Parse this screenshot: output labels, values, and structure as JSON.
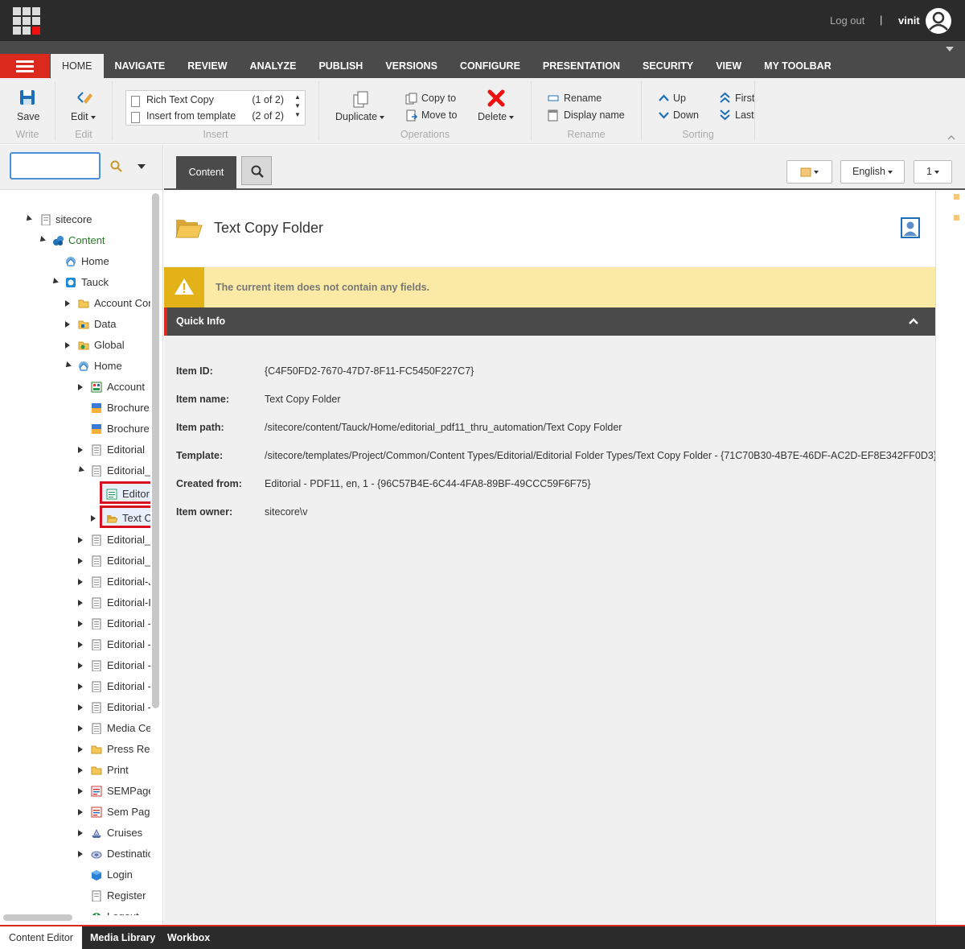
{
  "header": {
    "logout_label": "Log out",
    "separator": "|",
    "username": "vinit"
  },
  "ribbon": {
    "tabs": [
      "HOME",
      "NAVIGATE",
      "REVIEW",
      "ANALYZE",
      "PUBLISH",
      "VERSIONS",
      "CONFIGURE",
      "PRESENTATION",
      "SECURITY",
      "VIEW",
      "MY TOOLBAR"
    ],
    "active_tab": "HOME",
    "write": {
      "save_label": "Save",
      "group_label": "Write"
    },
    "edit": {
      "edit_label": "Edit",
      "group_label": "Edit"
    },
    "insert": {
      "items": [
        {
          "label": "Rich Text Copy",
          "count": "(1 of 2)"
        },
        {
          "label": "Insert from template",
          "count": "(2 of 2)"
        }
      ],
      "group_label": "Insert"
    },
    "operations": {
      "duplicate_label": "Duplicate",
      "copy_to_label": "Copy to",
      "move_to_label": "Move to",
      "delete_label": "Delete",
      "group_label": "Operations"
    },
    "rename": {
      "rename_label": "Rename",
      "display_name_label": "Display name",
      "group_label": "Rename"
    },
    "sorting": {
      "up_label": "Up",
      "down_label": "Down",
      "first_label": "First",
      "last_label": "Last",
      "group_label": "Sorting"
    }
  },
  "search": {
    "value": ""
  },
  "tree": [
    {
      "label": "sitecore",
      "icon": "sitecore-root-icon"
    },
    {
      "label": "Content",
      "icon": "content-icon"
    },
    {
      "label": "Home",
      "icon": "home-icon"
    },
    {
      "label": "Tauck",
      "icon": "site-icon"
    },
    {
      "label": "Account Con",
      "icon": "folder-icon"
    },
    {
      "label": "Data",
      "icon": "data-folder-icon"
    },
    {
      "label": "Global",
      "icon": "global-folder-icon"
    },
    {
      "label": "Home",
      "icon": "home-icon"
    },
    {
      "label": "Account",
      "icon": "account-icon"
    },
    {
      "label": "Brochure",
      "icon": "brochure-icon"
    },
    {
      "label": "Brochure.",
      "icon": "brochure-icon"
    },
    {
      "label": "Editorial",
      "icon": "document-icon"
    },
    {
      "label": "Editorial_",
      "icon": "document-icon"
    },
    {
      "label": "Editor",
      "icon": "rich-text-icon"
    },
    {
      "label": "Text C",
      "icon": "open-folder-icon"
    },
    {
      "label": "Editorial_",
      "icon": "document-icon"
    },
    {
      "label": "Editorial_",
      "icon": "document-icon"
    },
    {
      "label": "Editorial-J",
      "icon": "document-icon"
    },
    {
      "label": "Editorial-I",
      "icon": "document-icon"
    },
    {
      "label": "Editorial -",
      "icon": "document-icon"
    },
    {
      "label": "Editorial -",
      "icon": "document-icon"
    },
    {
      "label": "Editorial -",
      "icon": "document-icon"
    },
    {
      "label": "Editorial -",
      "icon": "document-icon"
    },
    {
      "label": "Editorial -",
      "icon": "document-icon"
    },
    {
      "label": "Media Ce",
      "icon": "document-icon"
    },
    {
      "label": "Press Rele",
      "icon": "folder-icon"
    },
    {
      "label": "Print",
      "icon": "folder-icon"
    },
    {
      "label": "SEMPage",
      "icon": "sem-page-icon"
    },
    {
      "label": "Sem Page",
      "icon": "sem-page-icon"
    },
    {
      "label": "Cruises",
      "icon": "cruise-icon"
    },
    {
      "label": "Destinatic",
      "icon": "destination-icon"
    },
    {
      "label": "Login",
      "icon": "login-icon"
    },
    {
      "label": "Register",
      "icon": "register-icon"
    },
    {
      "label": "Logout",
      "icon": "logout-icon"
    }
  ],
  "content_tabs": {
    "content_label": "Content",
    "language_label": "English",
    "version_label": "1"
  },
  "item": {
    "title": "Text Copy Folder",
    "warning": "The current item does not contain any fields.",
    "quick_info_title": "Quick Info",
    "quick_info": [
      {
        "key": "Item ID:",
        "value": "{C4F50FD2-7670-47D7-8F11-FC5450F227C7}"
      },
      {
        "key": "Item name:",
        "value": "Text Copy Folder"
      },
      {
        "key": "Item path:",
        "value": "/sitecore/content/Tauck/Home/editorial_pdf11_thru_automation/Text Copy Folder"
      },
      {
        "key": "Template:",
        "value": "/sitecore/templates/Project/Common/Content Types/Editorial/Editorial Folder Types/Text Copy Folder - {71C70B30-4B7E-46DF-AC2D-EF8E342FF0D3}"
      },
      {
        "key": "Created from:",
        "value": "Editorial - PDF11, en, 1 - {96C57B4E-6C44-4FA8-89BF-49CCC59F6F75}"
      },
      {
        "key": "Item owner:",
        "value": "sitecore\\v"
      }
    ]
  },
  "bottom_tabs": [
    "Content Editor",
    "Media Library",
    "Workbox"
  ],
  "colors": {
    "accent_red": "#dc291e",
    "warning_bg": "#fbe9a6",
    "warning_icon_bg": "#e3b218",
    "dark_bar": "#4a4a4a"
  }
}
